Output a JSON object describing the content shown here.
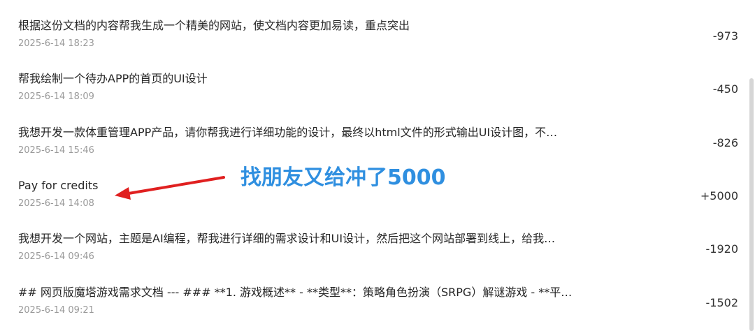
{
  "transactions": [
    {
      "description": "根据这份文档的内容帮我生成一个精美的网站，使文档内容更加易读，重点突出",
      "date": "2025-6-14 18:23",
      "amount": "-973"
    },
    {
      "description": "帮我绘制一个待办APP的首页的UI设计",
      "date": "2025-6-14 18:09",
      "amount": "-450"
    },
    {
      "description": "我想开发一款体重管理APP产品，请你帮我进行详细功能的设计，最终以html文件的形式输出UI设计图，不…",
      "date": "2025-6-14 15:46",
      "amount": "-826"
    },
    {
      "description": "Pay for credits",
      "date": "2025-6-14 14:08",
      "amount": "+5000"
    },
    {
      "description": "我想开发一个网站，主题是AI编程，帮我进行详细的需求设计和UI设计，然后把这个网站部署到线上，给我…",
      "date": "2025-6-14 09:46",
      "amount": "-1920"
    },
    {
      "description": "## 网页版魔塔游戏需求文档 --- ### **1. 游戏概述** - **类型**：策略角色扮演（SRPG）解谜游戏 - **平台*…",
      "date": "2025-6-14 09:21",
      "amount": "-1502"
    }
  ],
  "annotation": {
    "text": "找朋友又给冲了5000",
    "color": "#2f8fe0",
    "arrow_color": "#e02020"
  }
}
